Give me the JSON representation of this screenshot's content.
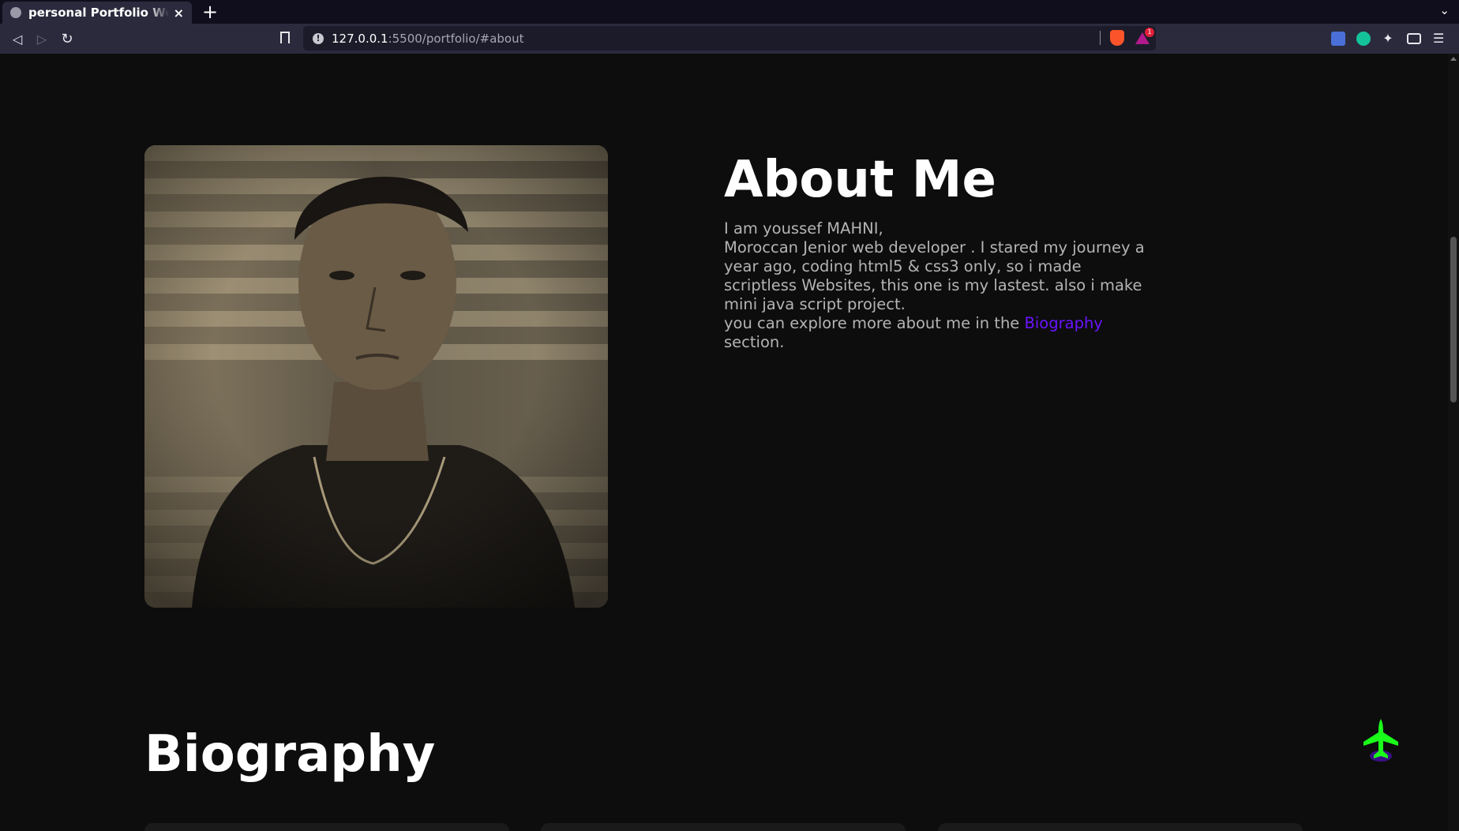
{
  "browser": {
    "tab_title": "personal Portfolio Website",
    "tab_close": "×",
    "new_tab": "+",
    "tab_list": "⌄",
    "url_host": "127.0.0.1",
    "url_path": ":5500/portfolio/#about",
    "info_symbol": "!",
    "rewards_badge": "1",
    "back": "◁",
    "forward": "▷",
    "reload": "↻",
    "menu": "☰"
  },
  "about": {
    "heading": "About Me",
    "line1": "I am youssef MAHNI,",
    "line2": "Moroccan Jenior web developer . I stared my journey a year ago, coding html5 & css3 only, so i made scriptless Websites, this one is my lastest. also i make mini java script project.",
    "line3_before": "you can explore more about me in the ",
    "line3_link": "Biography",
    "line3_after": " section."
  },
  "biography": {
    "heading": "Biography"
  },
  "colors": {
    "page_bg": "#0d0d0d",
    "accent_link": "#6a14ff",
    "plane_green": "#1aff1a",
    "plane_glow": "#6a14ff"
  }
}
